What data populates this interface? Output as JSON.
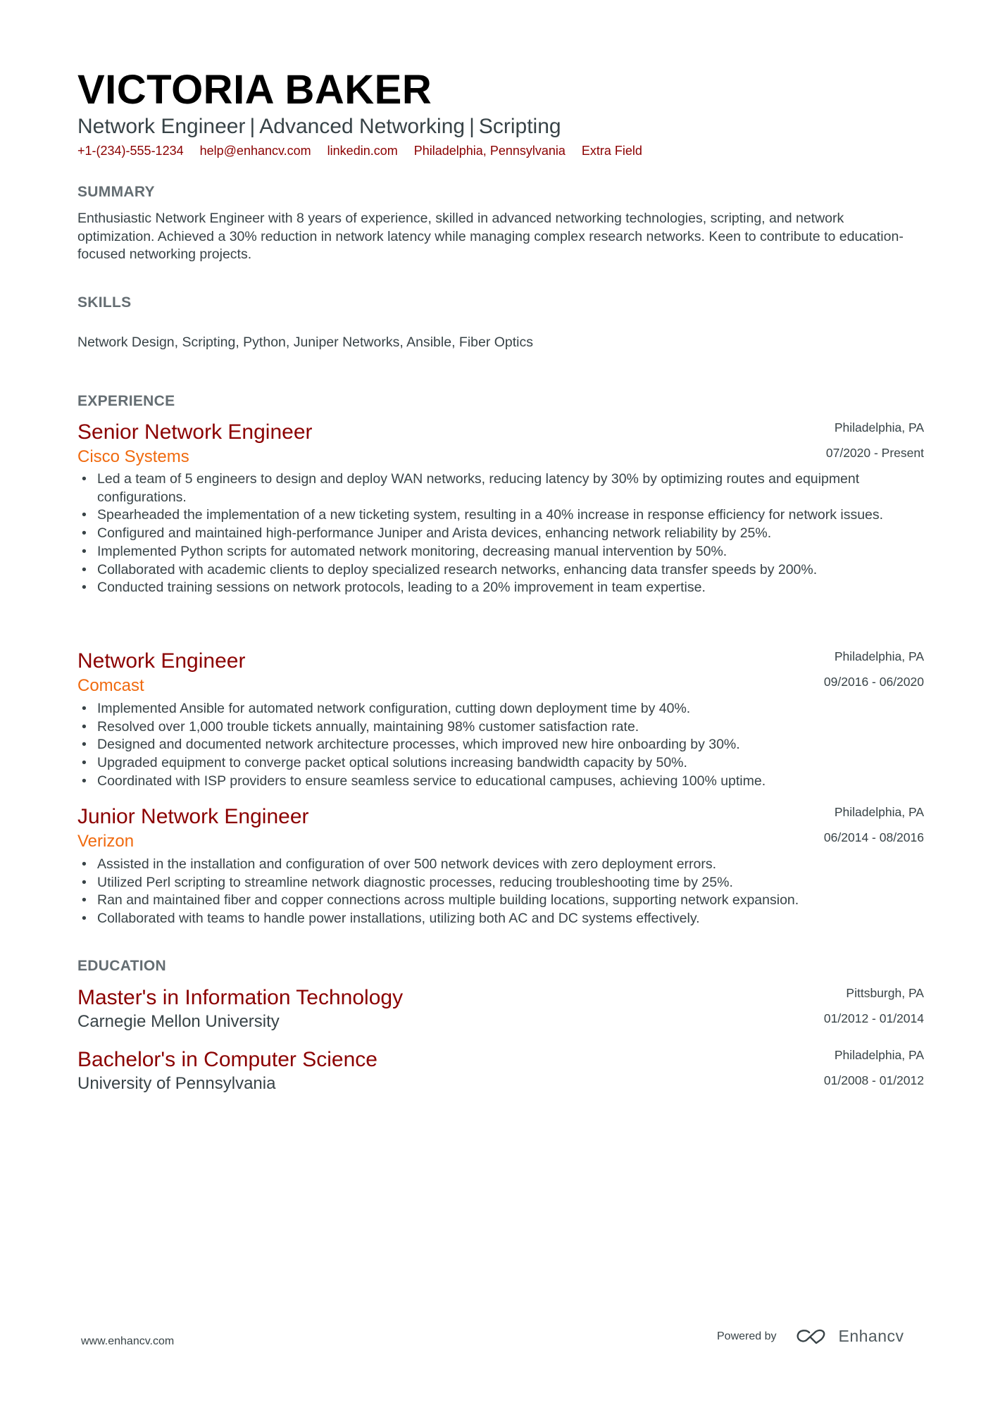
{
  "header": {
    "name": "VICTORIA BAKER",
    "title_parts": [
      "Network Engineer",
      "Advanced Networking",
      "Scripting"
    ],
    "title_separator": "|",
    "contacts": {
      "phone": "+1-(234)-555-1234",
      "email": "help@enhancv.com",
      "linkedin": "linkedin.com",
      "location": "Philadelphia, Pennsylvania",
      "extra": "Extra Field"
    }
  },
  "summary": {
    "heading": "SUMMARY",
    "text": "Enthusiastic Network Engineer with 8 years of experience, skilled in advanced networking technologies, scripting, and network optimization. Achieved a 30% reduction in network latency while managing complex research networks. Keen to contribute to education-focused networking projects."
  },
  "skills": {
    "heading": "SKILLS",
    "text": "Network Design, Scripting, Python, Juniper Networks, Ansible, Fiber Optics"
  },
  "experience": {
    "heading": "EXPERIENCE",
    "jobs": [
      {
        "title": "Senior Network Engineer",
        "company": "Cisco Systems",
        "location": "Philadelphia, PA",
        "dates": "07/2020 - Present",
        "bullets": [
          "Led a team of 5 engineers to design and deploy WAN networks, reducing latency by 30% by optimizing routes and equipment configurations.",
          "Spearheaded the implementation of a new ticketing system, resulting in a 40% increase in response efficiency for network issues.",
          "Configured and maintained high-performance Juniper and Arista devices, enhancing network reliability by 25%.",
          "Implemented Python scripts for automated network monitoring, decreasing manual intervention by 50%.",
          "Collaborated with academic clients to deploy specialized research networks, enhancing data transfer speeds by 200%.",
          "Conducted training sessions on network protocols, leading to a 20% improvement in team expertise."
        ]
      },
      {
        "title": "Network Engineer",
        "company": "Comcast",
        "location": "Philadelphia, PA",
        "dates": "09/2016 - 06/2020",
        "bullets": [
          "Implemented Ansible for automated network configuration, cutting down deployment time by 40%.",
          "Resolved over 1,000 trouble tickets annually, maintaining 98% customer satisfaction rate.",
          "Designed and documented network architecture processes, which improved new hire onboarding by 30%.",
          "Upgraded equipment to converge packet optical solutions increasing bandwidth capacity by 50%.",
          "Coordinated with ISP providers to ensure seamless service to educational campuses, achieving 100% uptime."
        ]
      },
      {
        "title": "Junior Network Engineer",
        "company": "Verizon",
        "location": "Philadelphia, PA",
        "dates": "06/2014 - 08/2016",
        "bullets": [
          "Assisted in the installation and configuration of over 500 network devices with zero deployment errors.",
          "Utilized Perl scripting to streamline network diagnostic processes, reducing troubleshooting time by 25%.",
          "Ran and maintained fiber and copper connections across multiple building locations, supporting network expansion.",
          "Collaborated with teams to handle power installations, utilizing both AC and DC systems effectively."
        ]
      }
    ]
  },
  "education": {
    "heading": "EDUCATION",
    "items": [
      {
        "degree": "Master's in Information Technology",
        "school": "Carnegie Mellon University",
        "location": "Pittsburgh, PA",
        "dates": "01/2012 - 01/2014"
      },
      {
        "degree": "Bachelor's in Computer Science",
        "school": "University of Pennsylvania",
        "location": "Philadelphia, PA",
        "dates": "01/2008 - 01/2012"
      }
    ]
  },
  "footer": {
    "website": "www.enhancv.com",
    "powered_by": "Powered by",
    "brand": "Enhancv",
    "brand_icon": "enhancv-logo-icon"
  },
  "colors": {
    "name": "#000000",
    "accent_dark_red": "#8b0000",
    "company_orange": "#f06a0f",
    "section_heading": "#646d72",
    "body_text": "#384347"
  }
}
